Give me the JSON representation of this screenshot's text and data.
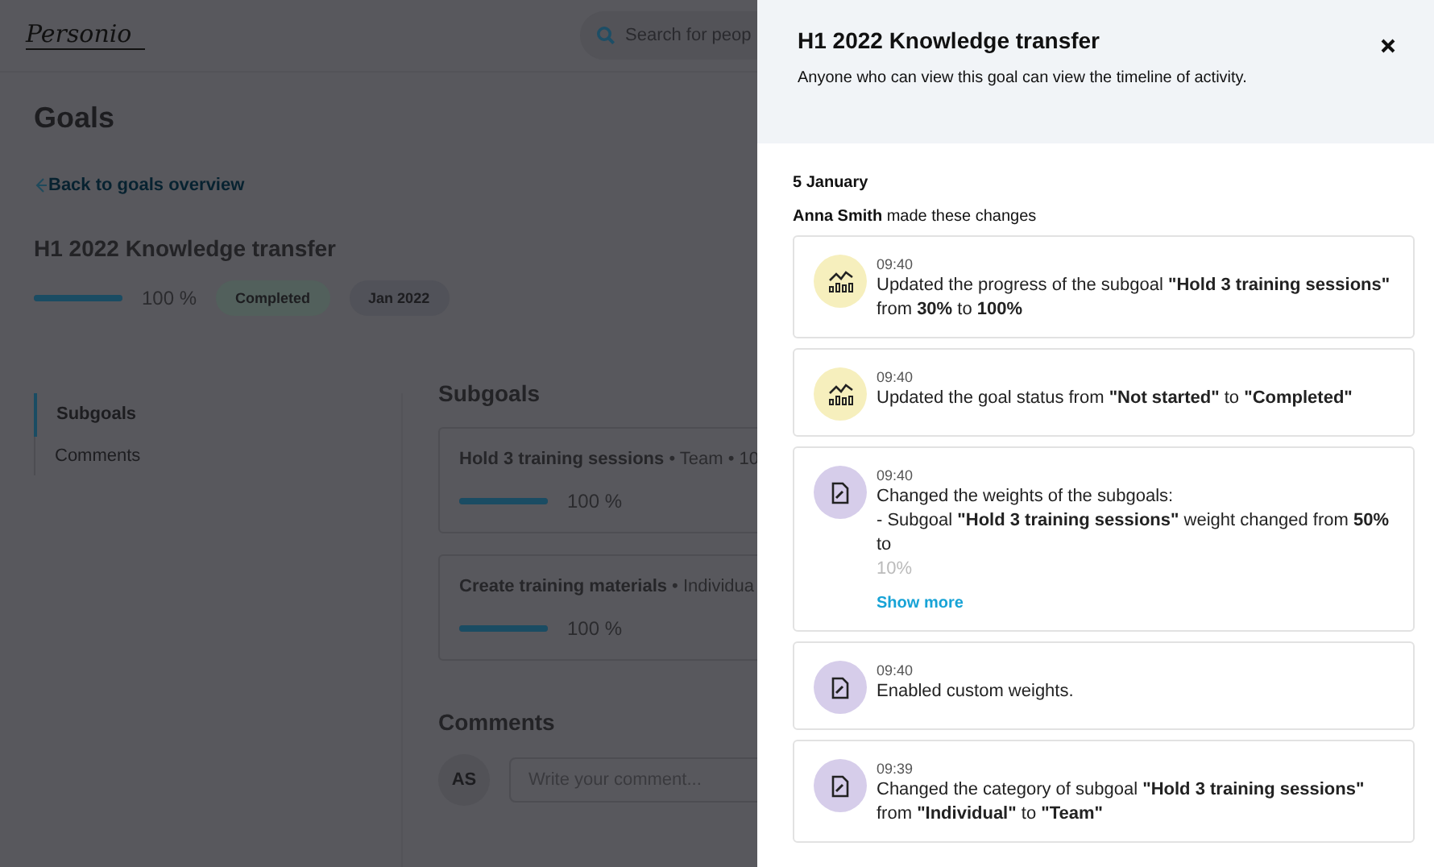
{
  "page": {
    "logo": "Personio",
    "search": {
      "placeholder": "Search for peop"
    },
    "title": "Goals",
    "back_link": "Back to goals overview",
    "goal": {
      "title": "H1 2022 Knowledge transfer",
      "level": 1,
      "percent": "100 %",
      "status": "Completed",
      "period": "Jan 2022"
    },
    "nav": [
      {
        "label": "Subgoals",
        "selected": true
      },
      {
        "label": "Comments",
        "selected": false
      }
    ],
    "subgoals_heading": "Subgoals",
    "subgoals": [
      {
        "name": "Hold 3 training sessions",
        "meta": " • Team • 10",
        "level": 1,
        "percent": "100 %"
      },
      {
        "name": "Create training materials",
        "meta": " • Individua",
        "level": 1,
        "percent": "100 %"
      }
    ],
    "comments_heading": "Comments",
    "avatar": "AS",
    "comment_field": {
      "placeholder": "Write your comment..."
    }
  },
  "panel": {
    "title": "H1 2022 Knowledge transfer",
    "subtitle": "Anyone who can view this goal can view the timeline of activity.",
    "date": "5 January",
    "author_line": "**Anna Smith** made these changes",
    "entries": [
      {
        "kind": "progress",
        "time": "09:40",
        "text": "Updated the progress of the subgoal **\"Hold 3 training sessions\"** from **30%** to **100%**"
      },
      {
        "kind": "progress",
        "time": "09:40",
        "text": "Updated the goal status from **\"Not started\"** to **\"Completed\"**"
      },
      {
        "kind": "edit",
        "time": "09:40",
        "lines": [
          "Changed the weights of the subgoals:",
          "- Subgoal **\"Hold 3 training sessions\"** weight changed from **50%** to",
          "10%"
        ],
        "show_more": "Show more"
      },
      {
        "kind": "edit",
        "time": "09:40",
        "text": "Enabled custom weights."
      },
      {
        "kind": "edit",
        "time": "09:39",
        "text": "Changed the category of subgoal **\"Hold 3 training sessions\"** from **\"Individual\"** to **\"Team\"**"
      }
    ]
  }
}
